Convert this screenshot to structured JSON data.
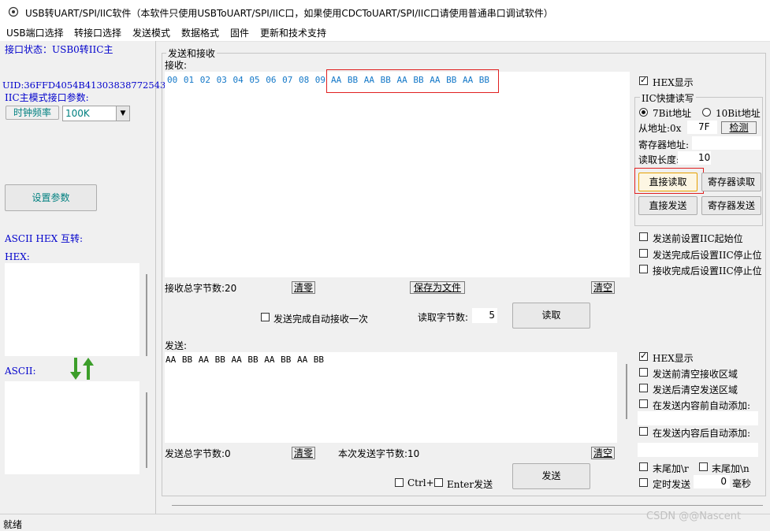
{
  "window": {
    "title": "USB转UART/SPI/IIC软件（本软件只使用USBToUART/SPI/IIC口，如果使用CDCToUART/SPI/IIC口请使用普通串口调试软件）"
  },
  "menu": [
    "USB端口选择",
    "转接口选择",
    "发送模式",
    "数据格式",
    "固件",
    "更新和技术支持"
  ],
  "left": {
    "status": "接口状态：USB0转IIC主",
    "uid": "UID:36FFD4054B41303838772543",
    "iic_params": "IIC主模式接口参数:",
    "clock_label": "时钟频率",
    "clock_value": "100K",
    "set_params": "设置参数",
    "ascii_hex_title": "ASCII HEX 互转:",
    "hex_label": "HEX:",
    "ascii_label": "ASCII:"
  },
  "main": {
    "group_title": "发送和接收",
    "recv_label": "接收:",
    "recv_plain": "00 01 02 03 04 05 06 07 08 09",
    "recv_highlight": "AA BB AA BB AA BB AA BB AA BB",
    "recv_total": "接收总字节数:20",
    "clear_recv": "清零",
    "save_file": "保存为文件",
    "empty_recv": "清空",
    "auto_recv_once": "发送完成自动接收一次",
    "read_bytes_label": "读取字节数:",
    "read_bytes_value": "5",
    "read_button": "读取",
    "send_label": "发送:",
    "send_text": "AA BB AA BB AA BB AA BB AA BB",
    "send_total": "发送总字节数:0",
    "clear_send": "清零",
    "this_send": "本次发送字节数:10",
    "empty_send": "清空",
    "ctrl": "Ctrl+",
    "enter_send": "Enter发送",
    "send_button": "发送"
  },
  "right_top": {
    "hex_display": "HEX显示",
    "iic_group": "IIC快捷读写",
    "bit7": "7Bit地址",
    "bit10": "10Bit地址",
    "slave_addr_label": "从地址:0x",
    "slave_addr_value": "7F",
    "detect": "检测",
    "reg_addr_label": "寄存器地址:",
    "read_len_label": "读取长度:",
    "read_len_value": "10",
    "direct_read": "直接读取",
    "reg_read": "寄存器读取",
    "direct_send": "直接发送",
    "reg_send": "寄存器发送",
    "opt1": "发送前设置IIC起始位",
    "opt2": "发送完成后设置IIC停止位",
    "opt3": "接收完成后设置IIC停止位"
  },
  "right_bottom": {
    "hex_display": "HEX显示",
    "clear_recv_before": "发送前清空接收区域",
    "clear_send_after": "发送后清空发送区域",
    "prefix": "在发送内容前自动添加:",
    "suffix": "在发送内容后自动添加:",
    "tail_r": "末尾加\\r",
    "tail_n": "末尾加\\n",
    "timed_send": "定时发送",
    "timed_value": "0",
    "ms": "毫秒"
  },
  "status": "就绪",
  "watermark": "CSDN @@Nascent",
  "colors": {
    "highlight_border": "#e02020",
    "hex_text": "#1478c8",
    "label_blue": "#0000cc"
  }
}
